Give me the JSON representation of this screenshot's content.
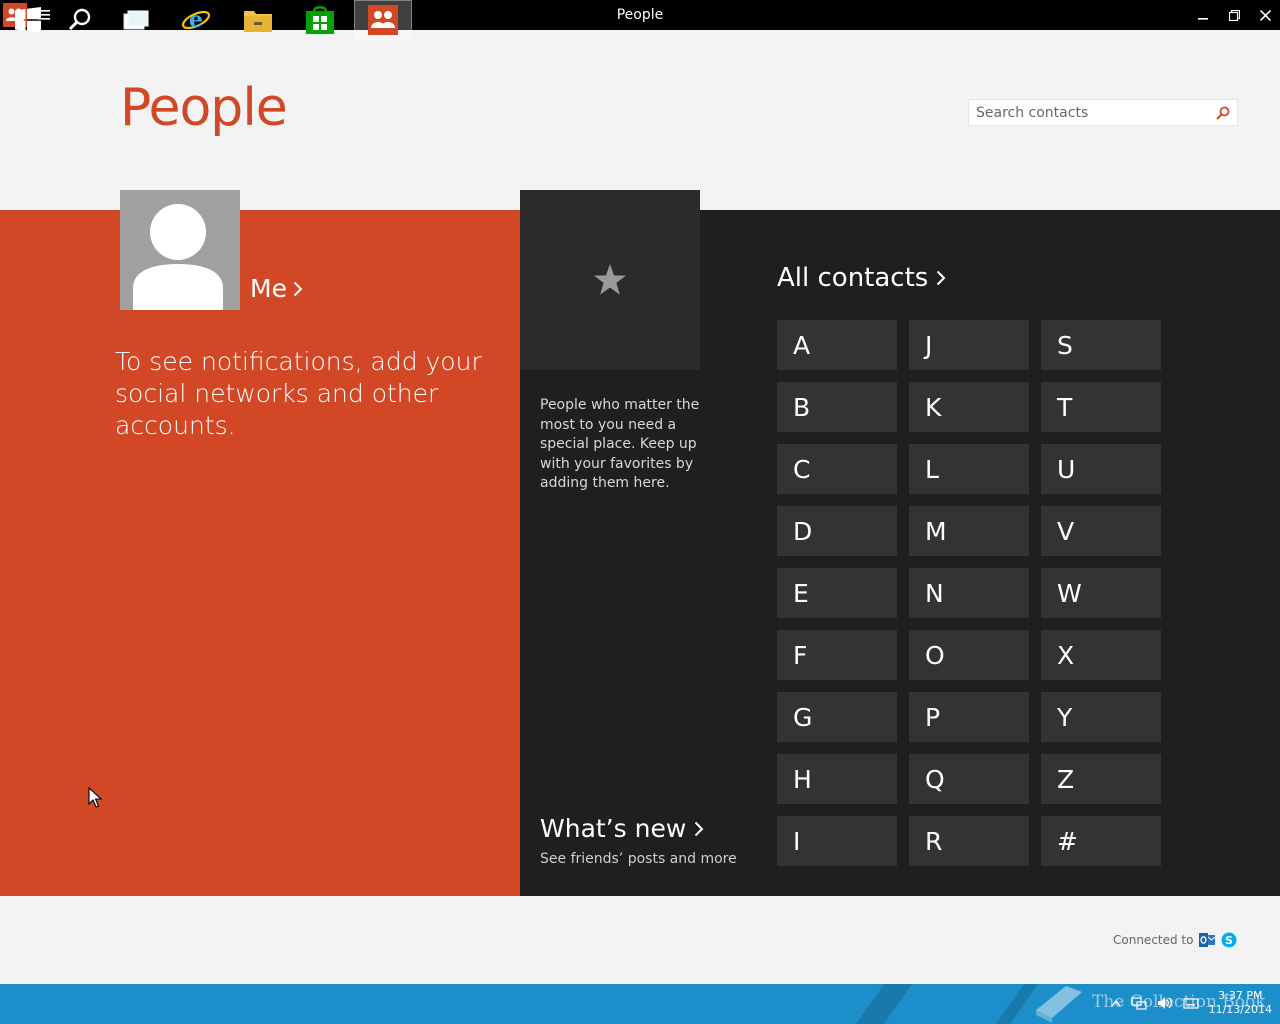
{
  "window": {
    "title": "People",
    "app_icon": "people-icon",
    "menu_icon": "hamburger-icon",
    "controls": [
      "minimize-icon",
      "restore-icon",
      "close-icon"
    ]
  },
  "header": {
    "title": "People",
    "search": {
      "placeholder": "Search contacts",
      "value": "",
      "icon": "search-icon"
    }
  },
  "me_panel": {
    "link_label": "Me",
    "notification_text": "To see notifications, add your social networks and other accounts.",
    "color": "#d24726"
  },
  "favorites": {
    "icon": "star-icon",
    "description": "People who matter the most to you need a special place. Keep up with your favorites by adding them here."
  },
  "whats_new": {
    "label": "What’s new",
    "subtitle": "See friends’ posts and more"
  },
  "all_contacts": {
    "label": "All contacts",
    "letters": [
      "A",
      "B",
      "C",
      "D",
      "E",
      "F",
      "G",
      "H",
      "I",
      "J",
      "K",
      "L",
      "M",
      "N",
      "O",
      "P",
      "Q",
      "R",
      "S",
      "T",
      "U",
      "V",
      "W",
      "X",
      "Y",
      "Z",
      "#"
    ]
  },
  "footer": {
    "connected_label": "Connected to",
    "services": [
      "outlook-icon",
      "skype-icon"
    ]
  },
  "taskbar": {
    "items": [
      "start-button",
      "search-button",
      "task-view-button",
      "internet-explorer-button",
      "file-explorer-button",
      "store-button",
      "people-button"
    ],
    "active": "people-button",
    "clock": {
      "time": "3:37 PM",
      "date": "11/13/2014"
    },
    "watermark": "The Collection Book"
  }
}
